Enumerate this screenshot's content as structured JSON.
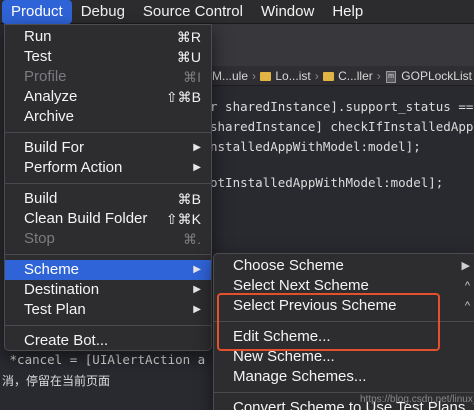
{
  "menubar": {
    "items": [
      "Product",
      "Debug",
      "Source Control",
      "Window",
      "Help"
    ]
  },
  "jumpbar": {
    "items": [
      "M...ule",
      "Lo...ist",
      "C...ller",
      "GOPLockList"
    ]
  },
  "editor": {
    "lines": [
      "r sharedInstance].support_status ==",
      "sharedInstance] checkIfInstalledAppV",
      "nstalledAppWithModel:model];",
      "",
      "otInstalledAppWithModel:model];"
    ],
    "bottom_lines": [
      " *cancel = [UIAlertAction a",
      "消，停留在当前页面",
      "",
      "                                  "
    ]
  },
  "product_menu": {
    "groups": [
      [
        {
          "label": "Run",
          "shortcut": "⌘R",
          "disabled": false
        },
        {
          "label": "Test",
          "shortcut": "⌘U",
          "disabled": false
        },
        {
          "label": "Profile",
          "shortcut": "⌘I",
          "disabled": true
        },
        {
          "label": "Analyze",
          "shortcut": "⇧⌘B",
          "disabled": false
        },
        {
          "label": "Archive",
          "shortcut": "",
          "disabled": false
        }
      ],
      [
        {
          "label": "Build For",
          "submenu": true
        },
        {
          "label": "Perform Action",
          "submenu": true
        }
      ],
      [
        {
          "label": "Build",
          "shortcut": "⌘B",
          "disabled": false
        },
        {
          "label": "Clean Build Folder",
          "shortcut": "⇧⌘K",
          "disabled": false
        },
        {
          "label": "Stop",
          "shortcut": "⌘.",
          "disabled": true
        }
      ],
      [
        {
          "label": "Scheme",
          "submenu": true,
          "selected": true
        },
        {
          "label": "Destination",
          "submenu": true
        },
        {
          "label": "Test Plan",
          "submenu": true
        }
      ],
      [
        {
          "label": "Create Bot...",
          "shortcut": ""
        }
      ]
    ]
  },
  "scheme_submenu": {
    "items": [
      "Choose Scheme",
      "Select Next Scheme",
      "Select Previous Scheme",
      "Edit Scheme...",
      "New Scheme...",
      "Manage Schemes...",
      "Convert Scheme to Use Test Plans..."
    ]
  },
  "watermark": "https://blog.csdn.net/linux_cwg",
  "colors": {
    "accent": "#2f64d8",
    "highlight_box": "#e2502c",
    "menu_bg": "#2d2d30"
  }
}
